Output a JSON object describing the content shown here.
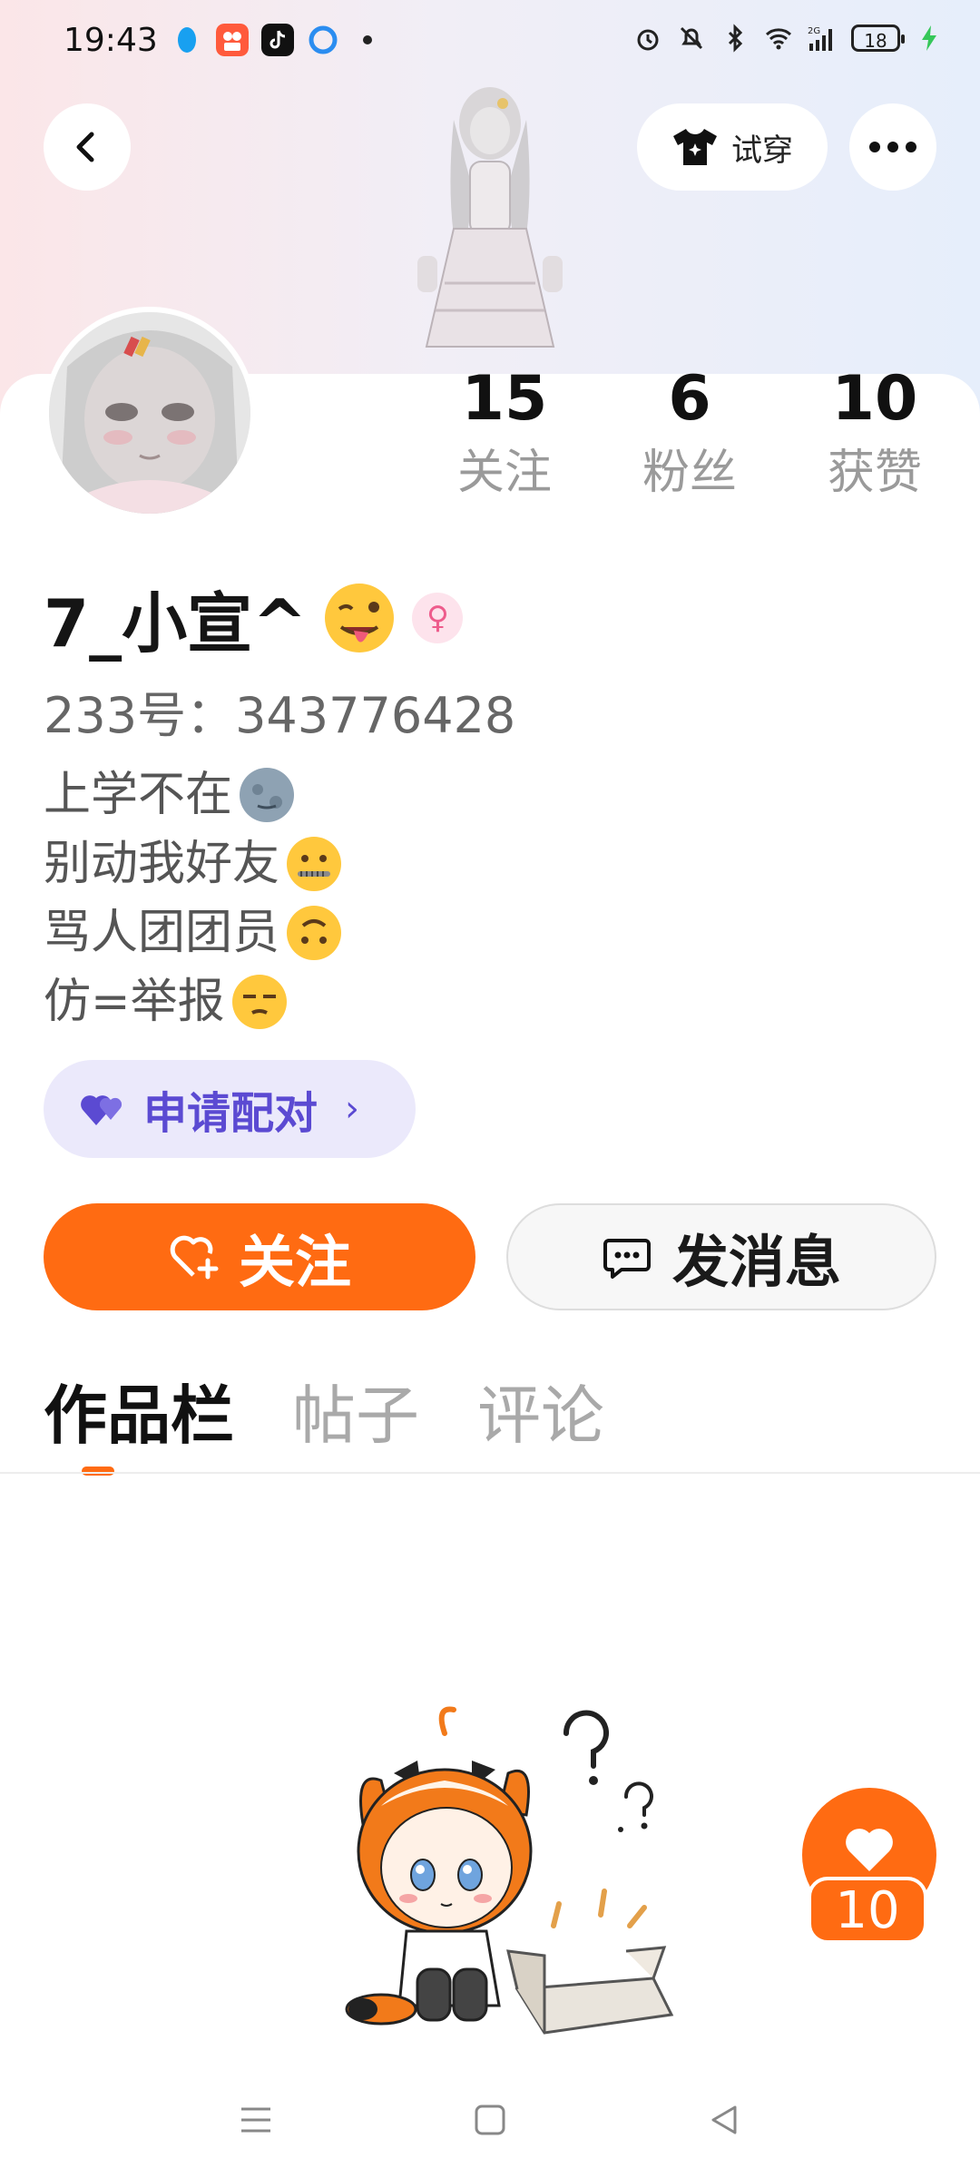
{
  "status_bar": {
    "time": "19:43",
    "network": "2G",
    "battery": "18"
  },
  "header": {
    "tryon_label": "试穿",
    "back_icon": "chevron-left-icon",
    "more_icon": "more-dots-icon"
  },
  "profile": {
    "stats": [
      {
        "value": "15",
        "label": "关注"
      },
      {
        "value": "6",
        "label": "粉丝"
      },
      {
        "value": "10",
        "label": "获赞"
      }
    ],
    "username": "7_小宣^",
    "uid": "233号：343776428",
    "bio": [
      {
        "text": "上学不在"
      },
      {
        "text": "别动我好友 "
      },
      {
        "text": "骂人团团员"
      },
      {
        "text": "仿=举报"
      }
    ],
    "pair_button": "申请配对",
    "follow_button": "关注",
    "message_button": "发消息"
  },
  "tabs": [
    {
      "label": "作品栏",
      "active": true
    },
    {
      "label": "帖子",
      "active": false
    },
    {
      "label": "评论",
      "active": false
    }
  ],
  "likes_fab": {
    "count": "10"
  },
  "colors": {
    "accent": "#ff6b12",
    "pair_text": "#5b4ad2",
    "pair_bg": "#ebe9fb"
  }
}
